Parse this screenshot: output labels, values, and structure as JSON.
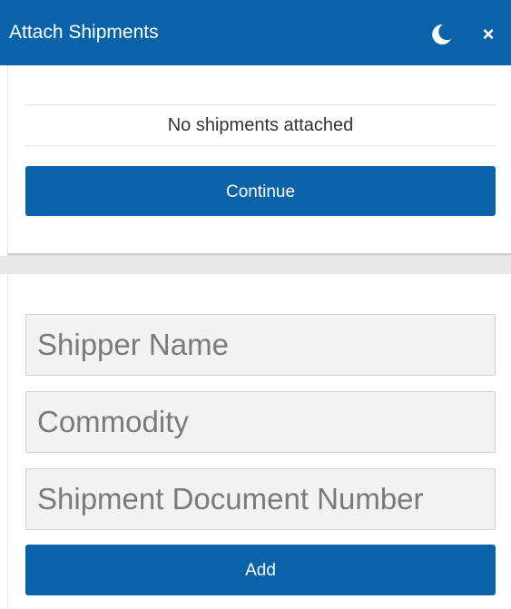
{
  "header": {
    "title": "Attach Shipments",
    "theme_icon": "moon-icon",
    "close_icon": "close-icon",
    "close_glyph": "×"
  },
  "shipments": {
    "empty_message": "No shipments attached",
    "continue_label": "Continue"
  },
  "form": {
    "shipper_name_placeholder": "Shipper Name",
    "commodity_placeholder": "Commodity",
    "document_number_placeholder": "Shipment Document Number",
    "add_label": "Add"
  },
  "colors": {
    "brand": "#0a62a8",
    "field_background": "#f2f2f2"
  }
}
